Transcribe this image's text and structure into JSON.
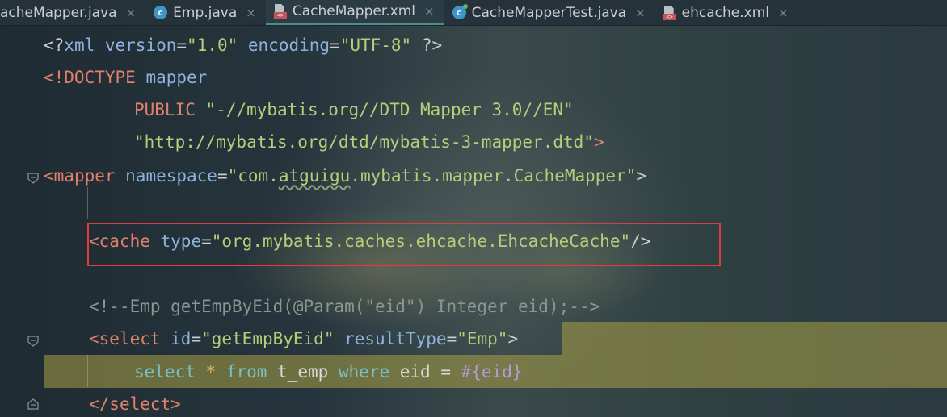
{
  "tabs": [
    {
      "label": "acheMapper.java",
      "icon": "java-interface-icon",
      "active": false
    },
    {
      "label": "Emp.java",
      "icon": "java-class-icon",
      "active": false
    },
    {
      "label": "CacheMapper.xml",
      "icon": "xml-file-icon",
      "active": true
    },
    {
      "label": "CacheMapperTest.java",
      "icon": "java-test-class-icon",
      "active": false
    },
    {
      "label": "ehcache.xml",
      "icon": "xml-file-icon",
      "active": false
    }
  ],
  "tab_close_glyph": "×",
  "code": {
    "l1": {
      "a": "<?",
      "b": "xml version",
      "c": "=",
      "d": "\"1.0\"",
      "e": " encoding",
      "f": "=",
      "g": "\"UTF-8\"",
      "h": " ?>"
    },
    "l2": {
      "a": "<!DOCTYPE ",
      "b": "mapper"
    },
    "l3": {
      "a": "PUBLIC ",
      "b": "\"-//mybatis.org//DTD Mapper 3.0//EN\""
    },
    "l4": {
      "a": "\"http://mybatis.org/dtd/mybatis-3-mapper.dtd\"",
      "b": ">"
    },
    "l5": {
      "a": "<",
      "b": "mapper",
      "c": " namespace",
      "d": "=",
      "e": "\"com.",
      "f": "atguigu",
      "g": ".mybatis.mapper.CacheMapper\"",
      "h": ">"
    },
    "l6": {
      "a": "<",
      "b": "cache",
      "c": " type",
      "d": "=",
      "e": "\"org.mybatis.caches.ehcache.EhcacheCache\"",
      "f": "/>"
    },
    "l7": {
      "a": "<!--Emp getEmpByEid(@Param(\"eid\") Integer eid);-->"
    },
    "l8": {
      "a": "<",
      "b": "select",
      "c": " id",
      "d": "=",
      "e": "\"getEmpByEid\"",
      "f": " resultType",
      "g": "=",
      "h": "\"Emp\"",
      "i": ">"
    },
    "l9": {
      "a": "select ",
      "b": "*",
      "c": " from ",
      "d": "t_emp ",
      "e": "where ",
      "f": "eid ",
      "g": "= ",
      "h": "#{eid}"
    },
    "l10": {
      "a": "</",
      "b": "select",
      "c": ">"
    }
  },
  "colors": {
    "tag": "#e0816c",
    "attribute": "#8fb2dc",
    "string": "#b3cf7a",
    "comment": "#8c9690",
    "highlight": "#aaa046",
    "annotation_box": "#e23b3b",
    "active_tab_underline": "#4a8f8a"
  }
}
